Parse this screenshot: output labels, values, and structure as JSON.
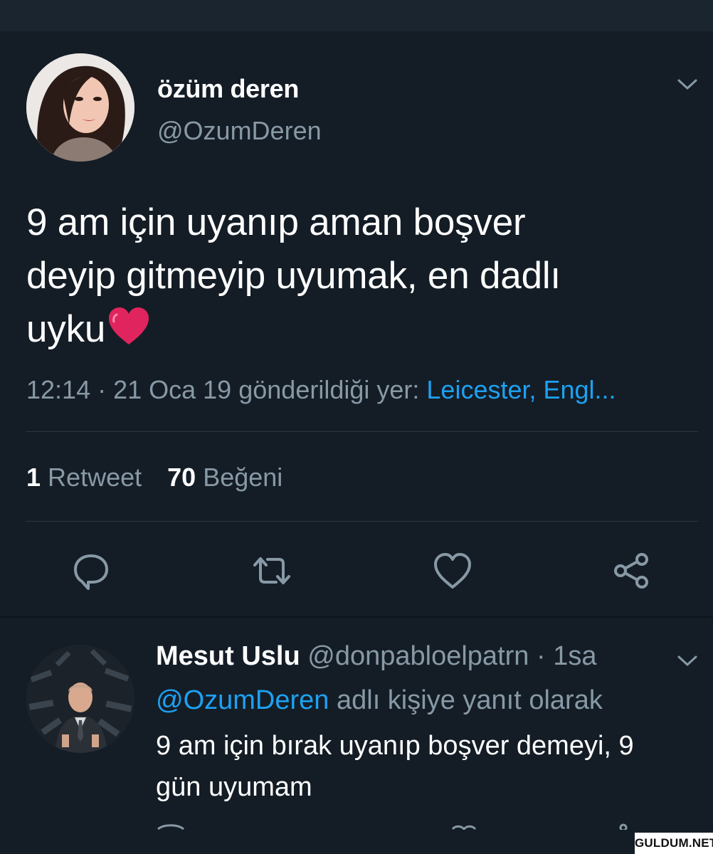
{
  "tweet": {
    "display_name": "özüm deren",
    "handle": "@OzumDeren",
    "text_line1": "9 am için uyanıp aman boşver",
    "text_line2": "deyip gitmeyip uyumak, en dadlı",
    "text_line3": "uyku",
    "emoji": "red-heart",
    "time": "12:14",
    "date": "21 Oca 19",
    "location_prefix": "gönderildiği yer:",
    "location": "Leicester, Engl...",
    "retweet_count": "1",
    "retweet_label": "Retweet",
    "like_count": "70",
    "like_label": "Beğeni"
  },
  "actions": [
    {
      "icon": "reply-icon"
    },
    {
      "icon": "retweet-icon"
    },
    {
      "icon": "like-icon"
    },
    {
      "icon": "share-icon"
    }
  ],
  "reply": {
    "display_name": "Mesut Uslu",
    "handle": "@donpabloelpatrn",
    "time": "1sa",
    "mention": "@OzumDeren",
    "reply_suffix": "adlı kişiye yanıt olarak",
    "text_line1": "9 am için bırak uyanıp boşver demeyi, 9",
    "text_line2": "gün uyumam"
  },
  "watermark": "GULDUM.NET",
  "colors": {
    "background": "#141d26",
    "secondary_text": "#8899a6",
    "link": "#1da1f2",
    "heart": "#e0245e"
  }
}
